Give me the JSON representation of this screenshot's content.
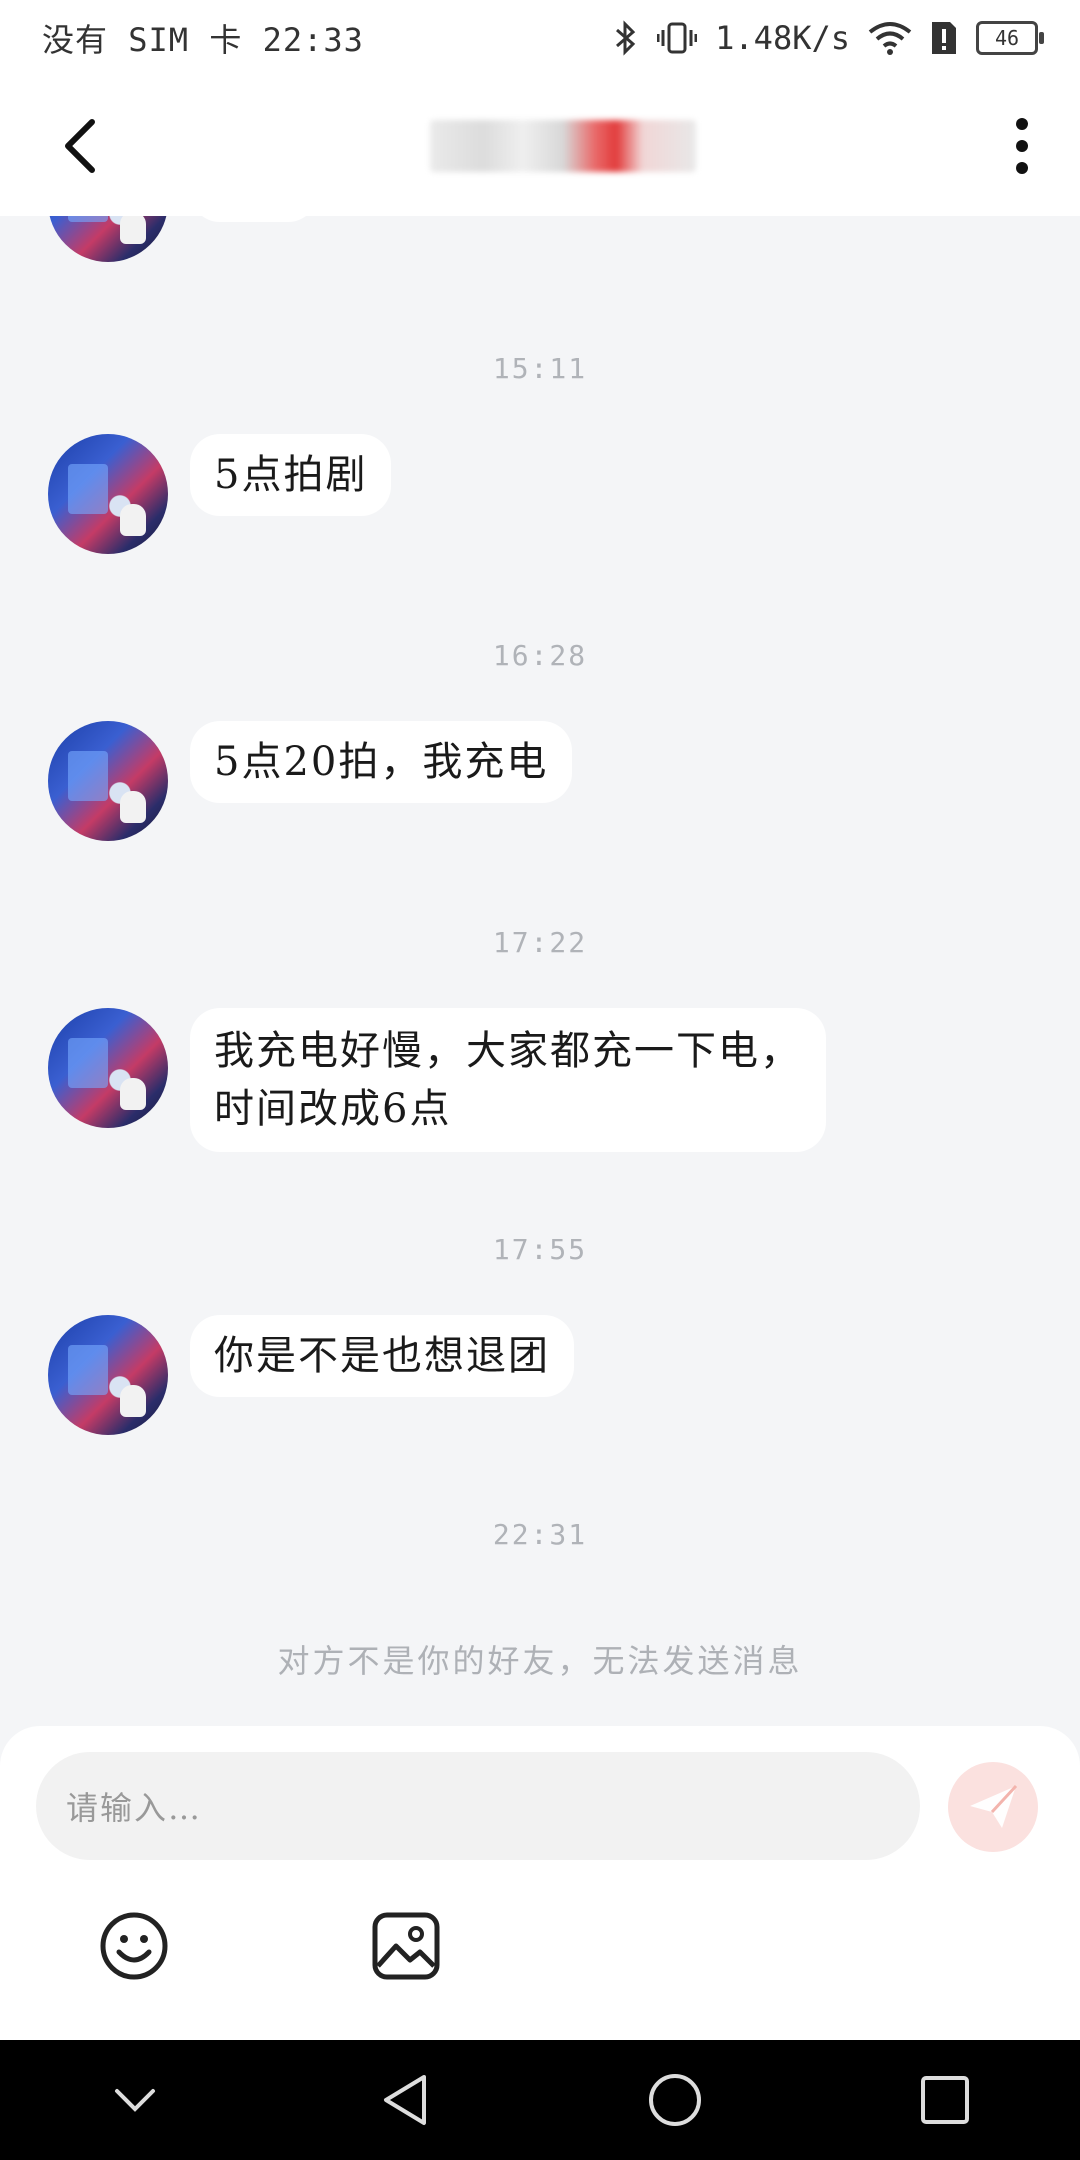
{
  "status_bar": {
    "carrier": "没有 SIM 卡",
    "time": "22:33",
    "network_speed": "1.48K/s",
    "battery": "46"
  },
  "header": {
    "back_icon": "chevron-left-icon",
    "more_icon": "more-vertical-icon"
  },
  "messages": [
    {
      "time": "15:11",
      "text": "5点拍剧"
    },
    {
      "time": "16:28",
      "text": "5点20拍，我充电"
    },
    {
      "time": "17:22",
      "text": "我充电好慢，大家都充一下电，",
      "text2": "时间改成6点"
    },
    {
      "time": "17:55",
      "text": "你是不是也想退团"
    }
  ],
  "last_time": "22:31",
  "notice": "对方不是你的好友，无法发送消息",
  "composer": {
    "placeholder": "请输入…",
    "send_icon": "send-icon",
    "emoji_icon": "emoji-icon",
    "image_icon": "image-icon"
  },
  "colors": {
    "background": "#f4f5f7",
    "bubble": "#ffffff",
    "send_disabled": "#fbe1df",
    "send_accent": "#f08a80"
  }
}
